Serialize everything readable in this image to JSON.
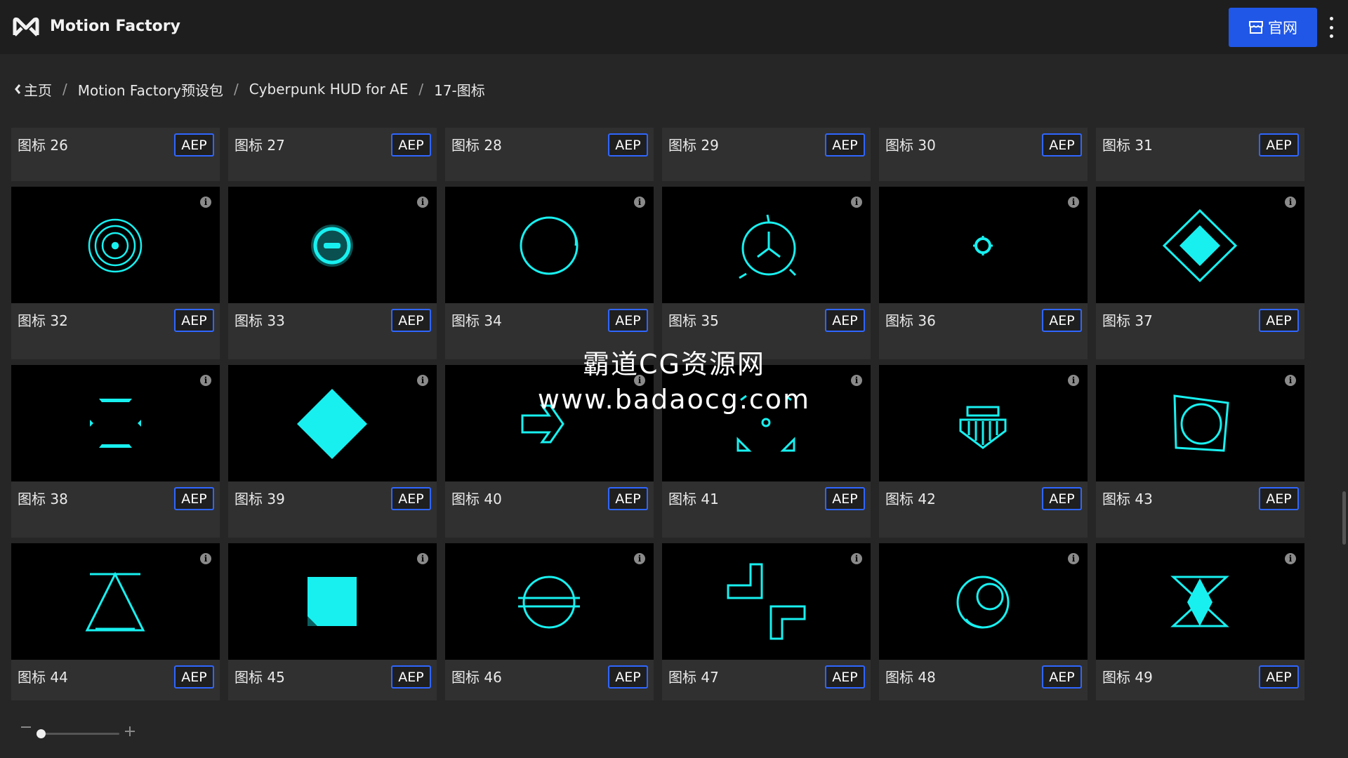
{
  "app": {
    "title": "Motion Factory"
  },
  "header": {
    "site_button_label": "官网"
  },
  "breadcrumb": {
    "items": [
      "主页",
      "Motion Factory预设包",
      "Cyberpunk HUD for AE",
      "17-图标"
    ],
    "separator": "/"
  },
  "first_row": [
    {
      "name": "图标 26",
      "badge": "AEP"
    },
    {
      "name": "图标 27",
      "badge": "AEP"
    },
    {
      "name": "图标 28",
      "badge": "AEP"
    },
    {
      "name": "图标 29",
      "badge": "AEP"
    },
    {
      "name": "图标 30",
      "badge": "AEP"
    },
    {
      "name": "图标 31",
      "badge": "AEP"
    }
  ],
  "cards": [
    {
      "name": "图标 32",
      "badge": "AEP",
      "icon": "concentric-target-icon"
    },
    {
      "name": "图标 33",
      "badge": "AEP",
      "icon": "glow-slash-circle-icon"
    },
    {
      "name": "图标 34",
      "badge": "AEP",
      "icon": "ring-icon"
    },
    {
      "name": "图标 35",
      "badge": "AEP",
      "icon": "triskelion-ring-icon"
    },
    {
      "name": "图标 36",
      "badge": "AEP",
      "icon": "small-gear-icon"
    },
    {
      "name": "图标 37",
      "badge": "AEP",
      "icon": "diamond-outline-icon"
    },
    {
      "name": "图标 38",
      "badge": "AEP",
      "icon": "bracket-frame-icon"
    },
    {
      "name": "图标 39",
      "badge": "AEP",
      "icon": "solid-diamond-icon"
    },
    {
      "name": "图标 40",
      "badge": "AEP",
      "icon": "arrow-right-icon"
    },
    {
      "name": "图标 41",
      "badge": "AEP",
      "icon": "triangle-corners-icon"
    },
    {
      "name": "图标 42",
      "badge": "AEP",
      "icon": "shield-emblem-icon"
    },
    {
      "name": "图标 43",
      "badge": "AEP",
      "icon": "square-ring-icon"
    },
    {
      "name": "图标 44",
      "badge": "AEP",
      "icon": "triangle-outline-icon"
    },
    {
      "name": "图标 45",
      "badge": "AEP",
      "icon": "solid-square-icon"
    },
    {
      "name": "图标 46",
      "badge": "AEP",
      "icon": "striped-circle-icon"
    },
    {
      "name": "图标 47",
      "badge": "AEP",
      "icon": "angled-blocks-icon"
    },
    {
      "name": "图标 48",
      "badge": "AEP",
      "icon": "crescent-orb-icon"
    },
    {
      "name": "图标 49",
      "badge": "AEP",
      "icon": "hourglass-diamond-icon"
    }
  ],
  "watermark": {
    "line1": "霸道CG资源网",
    "line2": "www.badaocg.com"
  },
  "colors": {
    "accent": "#2057e6",
    "badge_border": "#2f66ff",
    "icon_cyan": "#18f0f0"
  }
}
